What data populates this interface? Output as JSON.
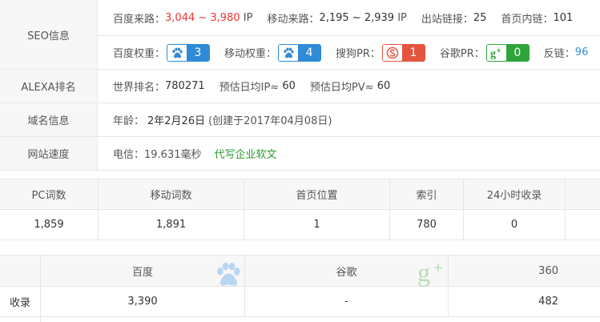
{
  "seo": {
    "label": "SEO信息",
    "baidu_source_label": "百度来路：",
    "baidu_source_value": "3,044 ~ 3,980",
    "baidu_source_unit": "IP",
    "mobile_source_label": "移动来路：",
    "mobile_source_value": "2,195 ~ 2,939",
    "mobile_source_unit": "IP",
    "outbound_label": "出站链接：",
    "outbound_value": "25",
    "home_internal_label": "首页内链：",
    "home_internal_value": "101",
    "baidu_weight_label": "百度权重：",
    "baidu_weight_value": "3",
    "mobile_weight_label": "移动权重：",
    "mobile_weight_value": "4",
    "sogou_pr_label": "搜狗PR：",
    "sogou_pr_value": "1",
    "google_pr_label": "谷歌PR：",
    "google_pr_value": "0",
    "backlink_label": "反链：",
    "backlink_value": "96"
  },
  "alexa": {
    "label": "ALEXA排名",
    "world_rank_label": "世界排名：",
    "world_rank_value": "780271",
    "daily_ip_label": "预估日均IP≈",
    "daily_ip_value": "60",
    "daily_pv_label": "预估日均PV≈",
    "daily_pv_value": "60"
  },
  "domain": {
    "label": "域名信息",
    "age_label": "年龄：",
    "age_value": "2年2月26日",
    "created_text": "(创建于2017年04月08日)"
  },
  "speed": {
    "label": "网站速度",
    "telecom_text": "电信：19.631毫秒",
    "ad_link": "代写企业软文"
  },
  "keywords": {
    "headers": [
      "PC词数",
      "移动词数",
      "首页位置",
      "索引",
      "24小时收录"
    ],
    "values": [
      "1,859",
      "1,891",
      "1",
      "780",
      "0"
    ]
  },
  "indexing": {
    "engines": [
      "百度",
      "谷歌",
      "360"
    ],
    "row_label": "收录",
    "values": [
      "3,390",
      "-",
      "482"
    ]
  },
  "colors": {
    "red": "#e33333",
    "blue": "#2f8ad8",
    "green": "#2ea43a",
    "sogou": "#e4553e",
    "header_bg": "#f7f7f7",
    "border": "#e6e6e6"
  },
  "icons": {
    "baidu_weight": "baidu-paw-icon",
    "mobile_weight": "baidu-paw-icon",
    "sogou_pr": "sogou-s-icon",
    "google_pr": "google-plus-icon",
    "baidu_engine": "baidu-paw-icon",
    "google_engine": "google-plus-icon"
  }
}
